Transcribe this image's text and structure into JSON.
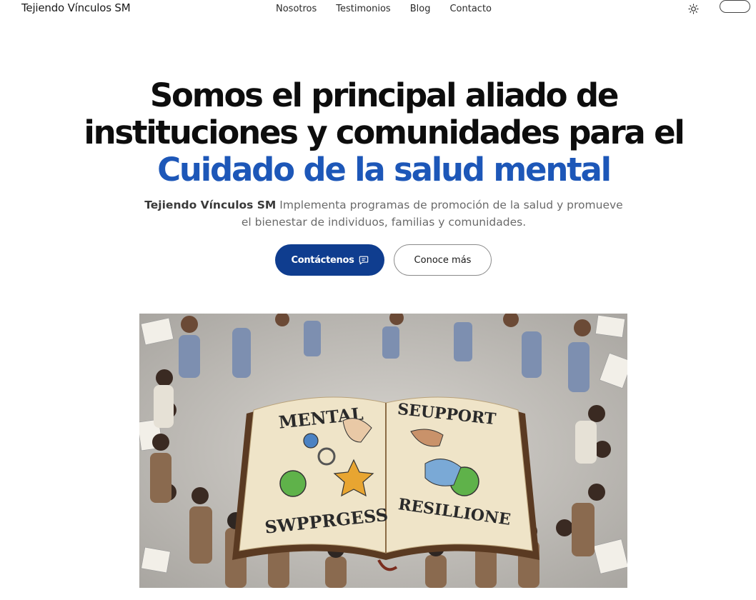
{
  "header": {
    "brand": "Tejiendo Vínculos SM",
    "nav": [
      "Nosotros",
      "Testimonios",
      "Blog",
      "Contacto"
    ],
    "theme_icon": "sun-icon"
  },
  "hero": {
    "title_line1": "Somos el principal aliado de",
    "title_line2": "instituciones y comunidades para el",
    "title_accent": "Cuidado de la salud mental",
    "subtitle_strong": "Tejiendo Vínculos SM",
    "subtitle_rest": " Implementa programas de promoción de la salud y promueve el bienestar de individuos, familias y comunidades.",
    "primary_button": "Contáctenos",
    "primary_icon": "message-icon",
    "secondary_button": "Conoce más"
  },
  "image": {
    "book_left_top": "MENTAL",
    "book_right_top": "SEUPPORT",
    "book_left_bottom": "SWPPRGESS",
    "book_right_bottom": "RESILLIONE"
  },
  "colors": {
    "accent": "#1d57b8",
    "primary_button": "#0f3d8f"
  }
}
